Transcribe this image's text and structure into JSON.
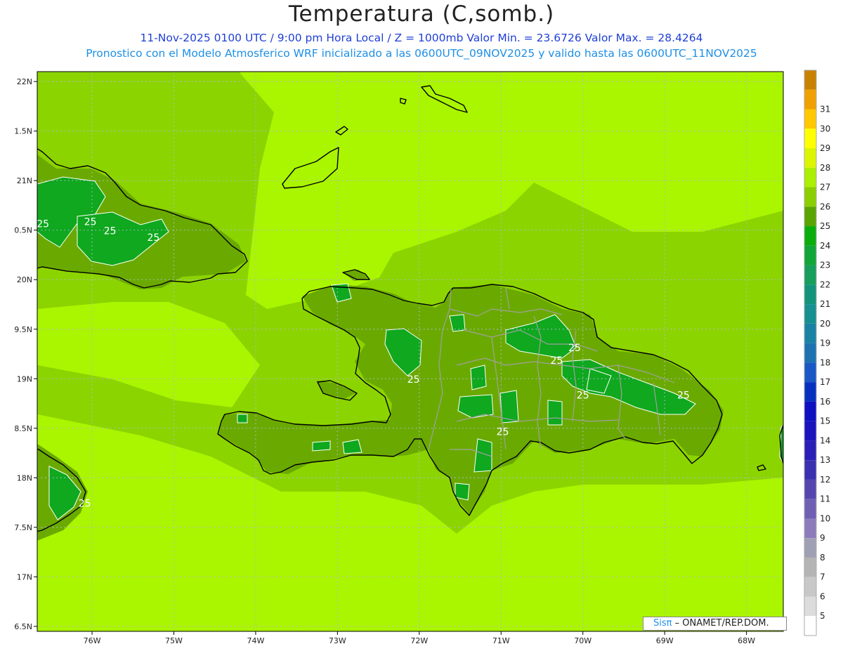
{
  "header": {
    "title": "Temperatura (C,somb.)",
    "subtitle_line1": "11-Nov-2025  0100 UTC / 9:00 pm Hora Local / Z = 1000mb    Valor Min. = 23.6726  Valor Max. = 28.4264",
    "subtitle_line2": "Pronostico con el Modelo Atmosferico WRF inicializado a las 0600UTC_09NOV2025 y valido hasta las  0600UTC_11NOV2025"
  },
  "map": {
    "lon_range": [
      -76.67,
      -67.55
    ],
    "lat_range": [
      16.45,
      22.1
    ],
    "lon_ticks": [
      {
        "value": -76,
        "label": "76W"
      },
      {
        "value": -75,
        "label": "75W"
      },
      {
        "value": -74,
        "label": "74W"
      },
      {
        "value": -73,
        "label": "73W"
      },
      {
        "value": -72,
        "label": "72W"
      },
      {
        "value": -71,
        "label": "71W"
      },
      {
        "value": -70,
        "label": "70W"
      },
      {
        "value": -69,
        "label": "69W"
      },
      {
        "value": -68,
        "label": "68W"
      }
    ],
    "lat_ticks": [
      {
        "value": 22,
        "label": "22N"
      },
      {
        "value": 21.5,
        "label": "1.5N"
      },
      {
        "value": 21,
        "label": "21N"
      },
      {
        "value": 20.5,
        "label": "0.5N"
      },
      {
        "value": 20,
        "label": "20N"
      },
      {
        "value": 19.5,
        "label": "9.5N"
      },
      {
        "value": 19,
        "label": "19N"
      },
      {
        "value": 18.5,
        "label": "8.5N"
      },
      {
        "value": 18,
        "label": "18N"
      },
      {
        "value": 17.5,
        "label": "7.5N"
      },
      {
        "value": 17,
        "label": "17N"
      },
      {
        "value": 16.5,
        "label": "6.5N"
      }
    ],
    "grid_lines": true,
    "colors": {
      "ocean_26": "#8cd400",
      "ocean_27": "#aaf500",
      "land_25": "#6aaa00",
      "land_24": "#0fa81e",
      "coast": "#000000",
      "borders": "#999999"
    },
    "contour_labels": [
      {
        "text": "25",
        "lon": -76.6,
        "lat": 20.53
      },
      {
        "text": "25",
        "lon": -76.02,
        "lat": 20.55
      },
      {
        "text": "25",
        "lon": -75.78,
        "lat": 20.46
      },
      {
        "text": "25",
        "lon": -75.25,
        "lat": 20.39
      },
      {
        "text": "25",
        "lon": -76.09,
        "lat": 17.71
      },
      {
        "text": "25",
        "lon": -72.07,
        "lat": 18.96
      },
      {
        "text": "25",
        "lon": -70.1,
        "lat": 19.28
      },
      {
        "text": "25",
        "lon": -70.32,
        "lat": 19.15
      },
      {
        "text": "25",
        "lon": -70.0,
        "lat": 18.8
      },
      {
        "text": "25",
        "lon": -70.98,
        "lat": 18.43
      },
      {
        "text": "25",
        "lon": -68.77,
        "lat": 18.8
      }
    ]
  },
  "colorbar": {
    "levels": [
      {
        "label": "",
        "color": "#ffffff"
      },
      {
        "label": "5",
        "color": "#dcdcdc"
      },
      {
        "label": "6",
        "color": "#c8c8c8"
      },
      {
        "label": "7",
        "color": "#b4b4b4"
      },
      {
        "label": "8",
        "color": "#a0a0b4"
      },
      {
        "label": "9",
        "color": "#8c7cbc"
      },
      {
        "label": "10",
        "color": "#7060b4"
      },
      {
        "label": "11",
        "color": "#5446ae"
      },
      {
        "label": "12",
        "color": "#3a30b0"
      },
      {
        "label": "13",
        "color": "#2a1eb8"
      },
      {
        "label": "14",
        "color": "#1a14be"
      },
      {
        "label": "15",
        "color": "#0e10c2"
      },
      {
        "label": "16",
        "color": "#0830c0"
      },
      {
        "label": "17",
        "color": "#1a58c6"
      },
      {
        "label": "18",
        "color": "#1d72b0"
      },
      {
        "label": "19",
        "color": "#1a82a4"
      },
      {
        "label": "20",
        "color": "#169090"
      },
      {
        "label": "21",
        "color": "#13947a"
      },
      {
        "label": "22",
        "color": "#169e5c"
      },
      {
        "label": "23",
        "color": "#10a638"
      },
      {
        "label": "24",
        "color": "#0aae0a"
      },
      {
        "label": "25",
        "color": "#5aa500"
      },
      {
        "label": "26",
        "color": "#8ccf00"
      },
      {
        "label": "27",
        "color": "#aaf000"
      },
      {
        "label": "28",
        "color": "#dcf500"
      },
      {
        "label": "29",
        "color": "#ffff00"
      },
      {
        "label": "30",
        "color": "#ffc800"
      },
      {
        "label": "31",
        "color": "#f0a000"
      },
      {
        "label": "",
        "color": "#c88200"
      }
    ]
  },
  "credit": {
    "brand": "Sisπ",
    "org": " – ONAMET/REP.DOM."
  }
}
